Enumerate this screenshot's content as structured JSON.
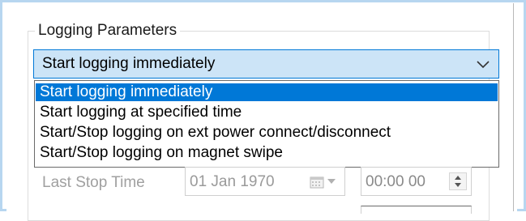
{
  "group": {
    "title": "Logging Parameters"
  },
  "combo": {
    "value": "Start logging immediately"
  },
  "options": [
    {
      "label": "Start logging immediately",
      "selected": true
    },
    {
      "label": "Start logging at specified time",
      "selected": false
    },
    {
      "label": "Start/Stop logging on ext power connect/disconnect",
      "selected": false
    },
    {
      "label": "Start/Stop logging on magnet swipe",
      "selected": false
    }
  ],
  "stop_row": {
    "label": "Last Stop Time",
    "date": "01 Jan  1970",
    "time": "00:00 00"
  },
  "icons": {
    "combo_arrow": "chevron-down-icon",
    "calendar": "calendar-icon",
    "calendar_arrow": "dropdown-arrow-icon",
    "spinner": "up-down-spinner-icon"
  },
  "colors": {
    "accent": "#0078d7",
    "combo_bg": "#cce4f7",
    "frame": "#b7d6f0",
    "disabled_text": "#a0a0a0"
  }
}
